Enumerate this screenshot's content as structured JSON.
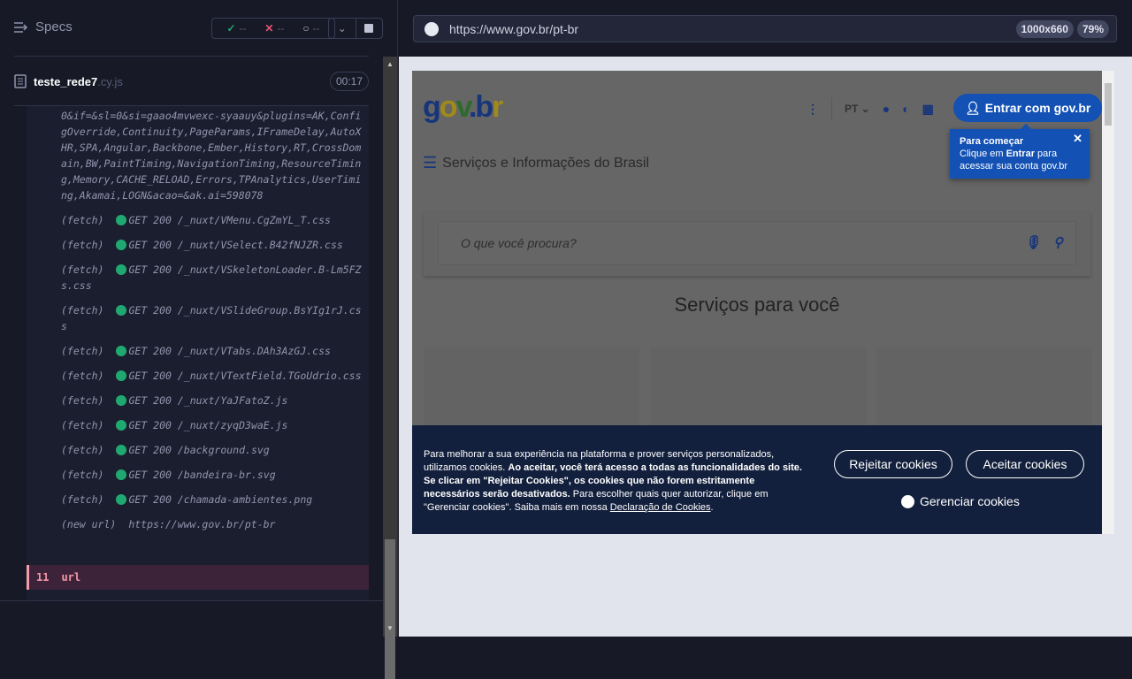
{
  "reporter": {
    "title": "Specs",
    "stats": {
      "passed": "--",
      "failed": "--",
      "pending": "--"
    },
    "spec": {
      "name": "teste_rede7",
      "ext": ".cy.js",
      "duration": "00:17"
    },
    "log": [
      {
        "type": "",
        "text": "0&if=&sl=0&si=gaao4mvwexc-syaauy&plugins=AK,ConfigOverride,Continuity,PageParams,IFrameDelay,AutoXHR,SPA,Angular,Backbone,Ember,History,RT,CrossDomain,BW,PaintTiming,NavigationTiming,ResourceTiming,Memory,CACHE_RELOAD,Errors,TPAnalytics,UserTiming,Akamai,LOGN&acao=&ak.ai=598078"
      },
      {
        "type": "(fetch)",
        "text": "GET 200 /_nuxt/VMenu.CgZmYL_T.css"
      },
      {
        "type": "(fetch)",
        "text": "GET 200 /_nuxt/VSelect.B42fNJZR.css"
      },
      {
        "type": "(fetch)",
        "text": "GET 200 /_nuxt/VSkeletonLoader.B-Lm5FZs.css"
      },
      {
        "type": "(fetch)",
        "text": "GET 200 /_nuxt/VSlideGroup.BsYIg1rJ.css"
      },
      {
        "type": "(fetch)",
        "text": "GET 200 /_nuxt/VTabs.DAh3AzGJ.css"
      },
      {
        "type": "(fetch)",
        "text": "GET 200 /_nuxt/VTextField.TGoUdrio.css"
      },
      {
        "type": "(fetch)",
        "text": "GET 200 /_nuxt/YaJFatoZ.js"
      },
      {
        "type": "(fetch)",
        "text": "GET 200 /_nuxt/zyqD3waE.js"
      },
      {
        "type": "(fetch)",
        "text": "GET 200 /background.svg"
      },
      {
        "type": "(fetch)",
        "text": "GET 200 /bandeira-br.svg"
      },
      {
        "type": "(fetch)",
        "text": "GET 200 /chamada-ambientes.png"
      },
      {
        "type": "(new url)",
        "text": "https://www.gov.br/pt-br"
      }
    ],
    "current": {
      "number": "11",
      "command": "url"
    }
  },
  "browser": {
    "url": "https://www.gov.br/pt-br",
    "viewport": "1000x660",
    "zoom": "79%"
  },
  "page": {
    "logo": "gov.br",
    "lang": "PT",
    "login": "Entrar com gov.br",
    "tooltip": {
      "title": "Para começar",
      "pre": "Clique em ",
      "bold": "Entrar",
      "post": " para acessar sua conta gov.br"
    },
    "menu": "Serviços e Informações do Brasil",
    "search_placeholder": "O que você procura?",
    "services_title": "Serviços para você",
    "cookie": {
      "t1": "Para melhorar a sua experiência na plataforma e prover serviços personalizados, utilizamos cookies. ",
      "b1": "Ao aceitar, você terá acesso a todas as funcionalidades do site. Se clicar em \"Rejeitar Cookies\", os cookies que não forem estritamente necessários serão desativados.",
      "t2": " Para escolher quais quer autorizar, clique em \"Gerenciar cookies\". Saiba mais em nossa ",
      "link": "Declaração de Cookies",
      "t3": ".",
      "reject": "Rejeitar cookies",
      "accept": "Aceitar cookies",
      "manage": "Gerenciar cookies"
    }
  },
  "colors": {
    "pass": "#1fa971",
    "fail": "#e45770",
    "gov_blue": "#1351b4"
  }
}
